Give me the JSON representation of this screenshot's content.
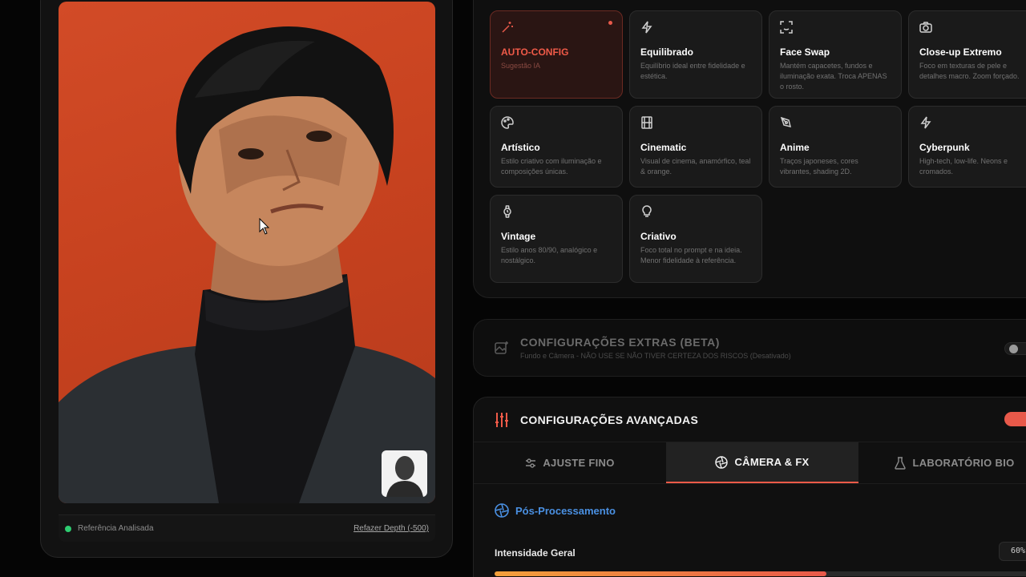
{
  "reference": {
    "status_label": "Referência Analisada",
    "redo_link": "Refazer Depth (-500)"
  },
  "styles": [
    {
      "title": "AUTO-CONFIG",
      "desc": "Sugestão IA",
      "icon": "magic-wand-icon",
      "active": true
    },
    {
      "title": "Equilibrado",
      "desc": "Equilíbrio ideal entre fidelidade e estética.",
      "icon": "lightning-icon"
    },
    {
      "title": "Face Swap",
      "desc": "Mantém capacetes, fundos e iluminação exata. Troca APENAS o rosto.",
      "icon": "face-scan-icon"
    },
    {
      "title": "Close-up Extremo",
      "desc": "Foco em texturas de pele e detalhes macro. Zoom forçado.",
      "icon": "camera-icon"
    },
    {
      "title": "Artístico",
      "desc": "Estilo criativo com iluminação e composições únicas.",
      "icon": "palette-icon"
    },
    {
      "title": "Cinematic",
      "desc": "Visual de cinema, anamórfico, teal & orange.",
      "icon": "film-icon"
    },
    {
      "title": "Anime",
      "desc": "Traços japoneses, cores vibrantes, shading 2D.",
      "icon": "pen-nib-icon"
    },
    {
      "title": "Cyberpunk",
      "desc": "High-tech, low-life. Neons e cromados.",
      "icon": "lightning-icon"
    },
    {
      "title": "Vintage",
      "desc": "Estilo anos 80/90, analógico e nostálgico.",
      "icon": "watch-icon"
    },
    {
      "title": "Criativo",
      "desc": "Foco total no prompt e na ideia. Menor fidelidade à referência.",
      "icon": "lightbulb-icon"
    }
  ],
  "extras": {
    "title": "CONFIGURAÇÕES EXTRAS (BETA)",
    "subtitle": "Fundo e Câmera - NÃO USE SE NÃO TIVER CERTEZA DOS RISCOS (Desativado)",
    "enabled": false
  },
  "advanced": {
    "title": "CONFIGURAÇÕES AVANÇADAS",
    "enabled": true,
    "tabs": [
      {
        "label": "AJUSTE FINO",
        "icon": "sliders-icon"
      },
      {
        "label": "CÂMERA & FX",
        "icon": "aperture-icon",
        "active": true
      },
      {
        "label": "LABORATÓRIO BIO",
        "icon": "flask-icon"
      }
    ],
    "section_title": "Pós-Processamento",
    "slider": {
      "label": "Intensidade Geral",
      "value_text": "60%",
      "value": 0.6
    }
  },
  "colors": {
    "accent": "#ef5a48",
    "section_blue": "#4a90e2",
    "status_green": "#2ecc71"
  }
}
